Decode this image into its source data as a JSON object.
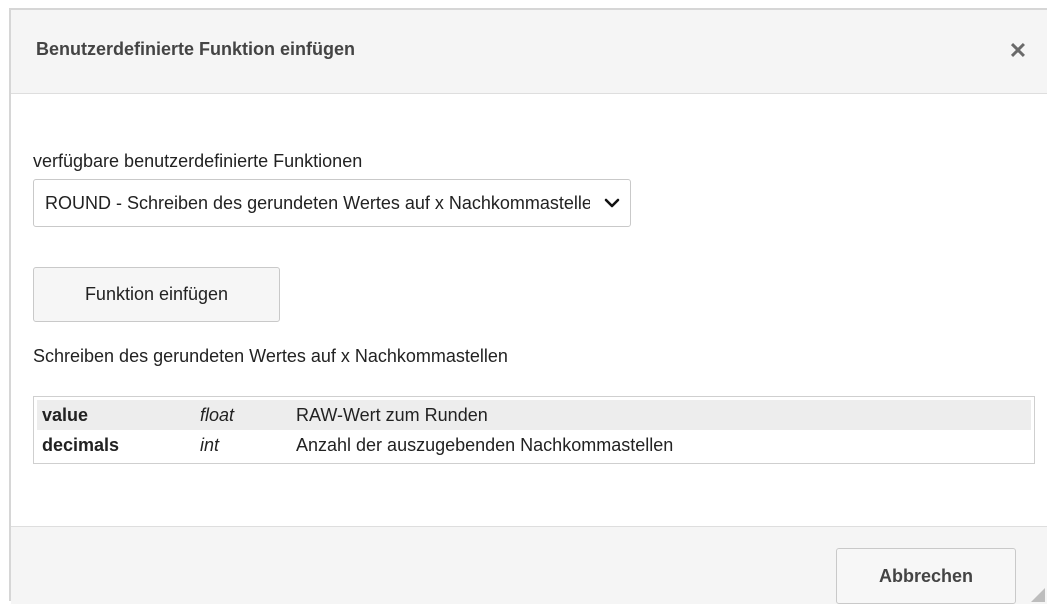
{
  "dialog": {
    "title": "Benutzerdefinierte Funktion einfügen",
    "close_icon": "close-icon"
  },
  "form": {
    "available_label": "verfügbare benutzerdefinierte Funktionen",
    "selected_function": "ROUND - Schreiben des gerundeten Wertes auf x Nachkommastellen",
    "insert_button_label": "Funktion einfügen",
    "description": "Schreiben des gerundeten Wertes auf x Nachkommastellen"
  },
  "parameters": [
    {
      "name": "value",
      "type": "float",
      "description": "RAW-Wert zum Runden"
    },
    {
      "name": "decimals",
      "type": "int",
      "description": "Anzahl der auszugebenden Nachkommastellen"
    }
  ],
  "footer": {
    "cancel_label": "Abbrechen"
  },
  "colors": {
    "header_bg": "#f5f5f5",
    "row_alt_bg": "#ededed",
    "border": "#c9c9c9"
  }
}
